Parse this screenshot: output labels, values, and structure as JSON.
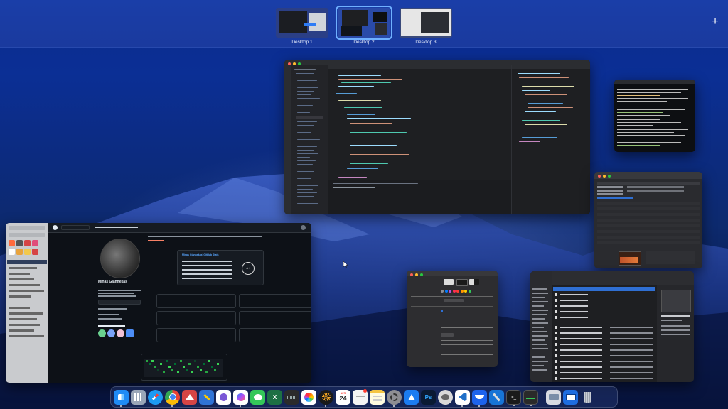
{
  "spaces": {
    "desktops": [
      {
        "label": "Desktop 1",
        "active": false
      },
      {
        "label": "Desktop 2",
        "active": true
      },
      {
        "label": "Desktop 3",
        "active": false
      }
    ],
    "add_icon": "plus-icon"
  },
  "windows": {
    "vscode": {
      "app": "Visual Studio Code"
    },
    "terminal": {
      "app": "Terminal"
    },
    "activity": {
      "app": "Activity Monitor"
    },
    "github": {
      "app": "Web Browser",
      "profile_name": "Minas Giannekas",
      "stats_title": "Minas Giannekas' GitHub Stats",
      "grade": "A+"
    },
    "prefs": {
      "app": "System Preferences"
    },
    "finder": {
      "app": "Finder"
    }
  },
  "dock": {
    "items": [
      {
        "name": "finder-icon",
        "color": "#1f8bf5"
      },
      {
        "name": "launchpad-icon",
        "color": "#9aa6b8"
      },
      {
        "name": "safari-icon",
        "color": "#1c9af2"
      },
      {
        "name": "chrome-icon",
        "color": "#e8e8e8"
      },
      {
        "name": "airmail-icon",
        "color": "#d64545"
      },
      {
        "name": "toolbox-icon",
        "color": "#2f73d6"
      },
      {
        "name": "viber-icon",
        "color": "#7b57d6"
      },
      {
        "name": "messenger-icon",
        "color": "#2e7cf6"
      },
      {
        "name": "messages-icon",
        "color": "#34c759"
      },
      {
        "name": "excel-icon",
        "color": "#1d7044"
      },
      {
        "name": "audio-icon",
        "color": "#2b2b2b"
      },
      {
        "name": "photos-icon",
        "color": "#f0f0f0"
      },
      {
        "name": "kite-icon",
        "color": "#1a1a1a"
      },
      {
        "name": "calendar-icon",
        "color": "#ffffff"
      },
      {
        "name": "reminders-icon",
        "color": "#f4f4f4"
      },
      {
        "name": "notes-icon",
        "color": "#fff2a8"
      },
      {
        "name": "settings-icon",
        "color": "#8e8e93"
      },
      {
        "name": "appstore-icon",
        "color": "#1b7cf2"
      },
      {
        "name": "photoshop-icon",
        "color": "#0a1a33"
      },
      {
        "name": "sequel-icon",
        "color": "#d9d9d9"
      },
      {
        "name": "vscode-icon",
        "color": "#1f6fc8"
      },
      {
        "name": "docker-icon",
        "color": "#1d63ed"
      },
      {
        "name": "xcode-icon",
        "color": "#1774d6"
      },
      {
        "name": "terminal-icon",
        "color": "#1a1a1a"
      },
      {
        "name": "activity-icon",
        "color": "#2a2a2a"
      }
    ],
    "trailing": [
      {
        "name": "folder-icon",
        "color": "#d8dbe2"
      },
      {
        "name": "desktop-folder-icon",
        "color": "#1e6de0"
      },
      {
        "name": "trash-icon",
        "color": "#c7ccd4"
      }
    ],
    "calendar_day": "24",
    "calendar_month": "APR",
    "photoshop_label": "Ps",
    "excel_label": "X"
  }
}
